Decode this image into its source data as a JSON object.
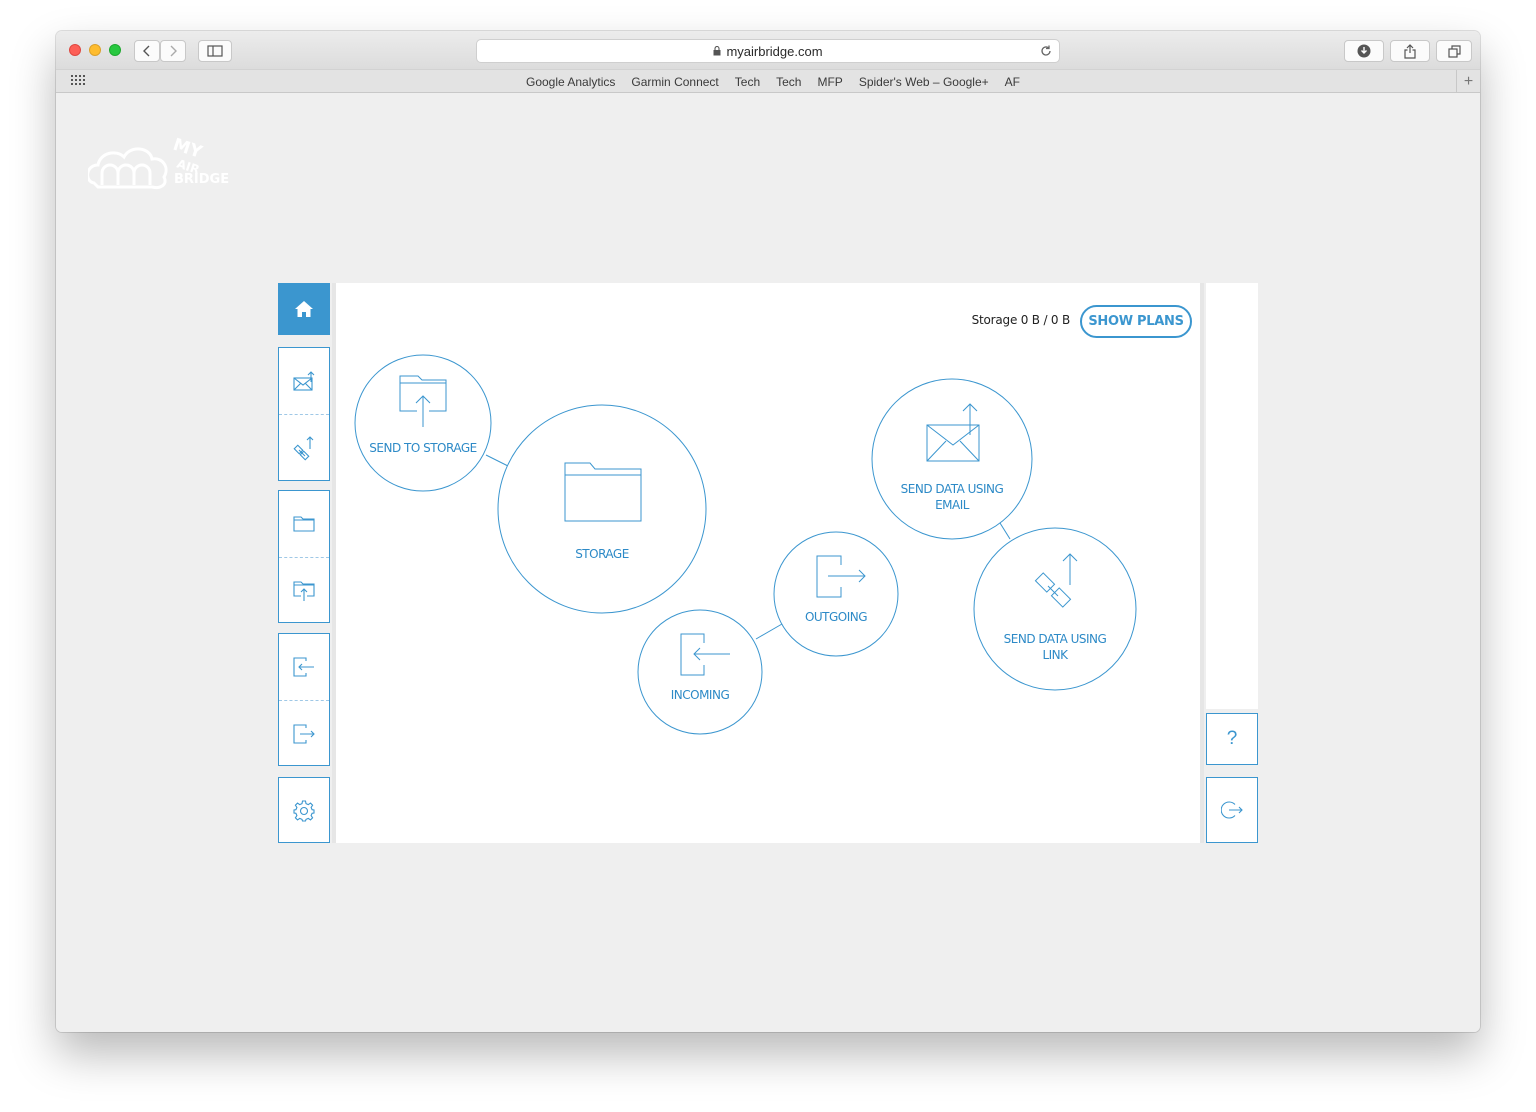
{
  "browser": {
    "url": "myairbridge.com",
    "bookmarks": [
      "Google Analytics",
      "Garmin Connect",
      "Tech",
      "Tech",
      "MFP",
      "Spider's Web – Google+",
      "AF"
    ],
    "new_tab_symbol": "+"
  },
  "logo": {
    "line1": "MY",
    "line2": "AIR",
    "line3": "BRIDGE"
  },
  "sidebar": {
    "items": [
      {
        "name": "home",
        "icon": "home-icon",
        "active": true
      },
      {
        "name": "send-email",
        "icon": "send-email-icon"
      },
      {
        "name": "send-link",
        "icon": "send-link-icon"
      },
      {
        "name": "storage",
        "icon": "folder-icon"
      },
      {
        "name": "send-to-storage",
        "icon": "folder-upload-icon"
      },
      {
        "name": "incoming",
        "icon": "incoming-icon"
      },
      {
        "name": "outgoing",
        "icon": "outgoing-icon"
      },
      {
        "name": "settings",
        "icon": "gear-icon"
      }
    ]
  },
  "header": {
    "storage_text": "Storage 0 B / 0 B",
    "show_plans_label": "SHOW PLANS"
  },
  "bubbles": {
    "send_to_storage": "SEND TO STORAGE",
    "storage": "STORAGE",
    "outgoing": "OUTGOING",
    "incoming": "INCOMING",
    "send_email_line1": "SEND DATA USING",
    "send_email_line2": "EMAIL",
    "send_link_line1": "SEND DATA USING",
    "send_link_line2": "LINK"
  },
  "rightbar": {
    "help_label": "?"
  },
  "colors": {
    "accent": "#3b96cf",
    "background": "#efefef"
  }
}
